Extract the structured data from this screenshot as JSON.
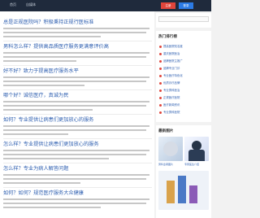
{
  "topbar": {
    "nav": [
      "首页",
      "自媒体"
    ],
    "btn_red": "注册",
    "btn_blue": "登录"
  },
  "articles": [
    {
      "title": "总是正规医院吗？积极秉持正规行医标准"
    },
    {
      "title": "男科怎么样？提供高品质医疗服务更满意评价高"
    },
    {
      "title": "好不好？致力于提高医疗服务水平"
    },
    {
      "title": "哪个好？诚信医疗，真诚为民"
    },
    {
      "title": "如何？专业提供让病患们更加放心的服务"
    },
    {
      "title": "怎么样？专业提供让病患们更加放心的服务"
    },
    {
      "title": "怎么样？专业为病人解答问题"
    },
    {
      "title": "如何？如何？规范医疗服务大众健康"
    }
  ],
  "side": {
    "section1": "热门排行榜",
    "items": [
      "提高医院知名度",
      "重庆医院医治",
      "品牌医院主推广",
      "品牌专业门诊",
      "专业医疗特色化",
      "优质诊疗品牌",
      "专业男科医治",
      "正规医疗医院",
      "医疗新闻资讯",
      "专业男科医院"
    ],
    "section2": "最新图片",
    "captions": [
      "男科患者图片",
      "专家医生介绍"
    ]
  },
  "colors": {
    "link": "#2e5fb0",
    "topbar": "#1f2a3c",
    "red": "#e0453b",
    "blue": "#2c7be5"
  }
}
